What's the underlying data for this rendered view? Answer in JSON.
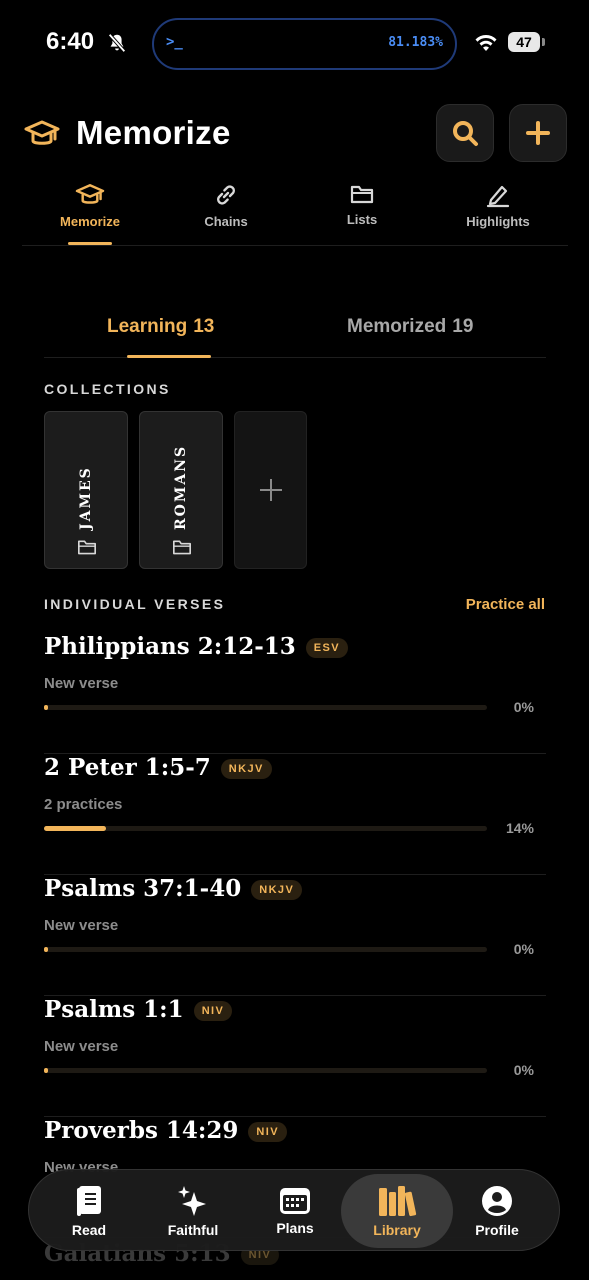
{
  "status_bar": {
    "time": "6:40",
    "island_prompt": ">_",
    "island_value": "81.183%",
    "battery": "47"
  },
  "header": {
    "title": "Memorize",
    "search_icon": "magnifier-icon",
    "add_icon": "plus-icon"
  },
  "top_tabs": [
    {
      "label": "Memorize",
      "icon": "graduation-cap-icon",
      "active": true
    },
    {
      "label": "Chains",
      "icon": "link-icon",
      "active": false
    },
    {
      "label": "Lists",
      "icon": "folder-icon",
      "active": false
    },
    {
      "label": "Highlights",
      "icon": "pen-icon",
      "active": false
    }
  ],
  "segments": {
    "learning": {
      "label": "Learning",
      "count": "13"
    },
    "memorized": {
      "label": "Memorized",
      "count": "19"
    }
  },
  "collections": {
    "label": "COLLECTIONS",
    "items": [
      {
        "name": "JAMES"
      },
      {
        "name": "ROMANS"
      }
    ]
  },
  "individual": {
    "label": "INDIVIDUAL VERSES",
    "practice_all": "Practice all",
    "verses": [
      {
        "ref": "Philippians 2:12-13",
        "translation": "ESV",
        "subtitle": "New verse",
        "progress": 0,
        "progress_label": "0%"
      },
      {
        "ref": "2 Peter 1:5-7",
        "translation": "NKJV",
        "subtitle": "2 practices",
        "progress": 14,
        "progress_label": "14%"
      },
      {
        "ref": "Psalms 37:1-40",
        "translation": "NKJV",
        "subtitle": "New verse",
        "progress": 0,
        "progress_label": "0%"
      },
      {
        "ref": "Psalms 1:1",
        "translation": "NIV",
        "subtitle": "New verse",
        "progress": 0,
        "progress_label": "0%"
      },
      {
        "ref": "Proverbs 14:29",
        "translation": "NIV",
        "subtitle": "New verse",
        "progress": 0,
        "progress_label": ""
      }
    ],
    "peek": {
      "ref": "Galatians 5:13",
      "translation": "NIV"
    }
  },
  "bottom_nav": [
    {
      "label": "Read",
      "icon": "book-icon",
      "active": false
    },
    {
      "label": "Faithful",
      "icon": "sparkles-icon",
      "active": false
    },
    {
      "label": "Plans",
      "icon": "calendar-icon",
      "active": false
    },
    {
      "label": "Library",
      "icon": "books-icon",
      "active": true
    },
    {
      "label": "Profile",
      "icon": "user-icon",
      "active": false
    }
  ],
  "colors": {
    "accent": "#f2b55a",
    "background": "#000000",
    "island_text": "#4a8df5"
  }
}
